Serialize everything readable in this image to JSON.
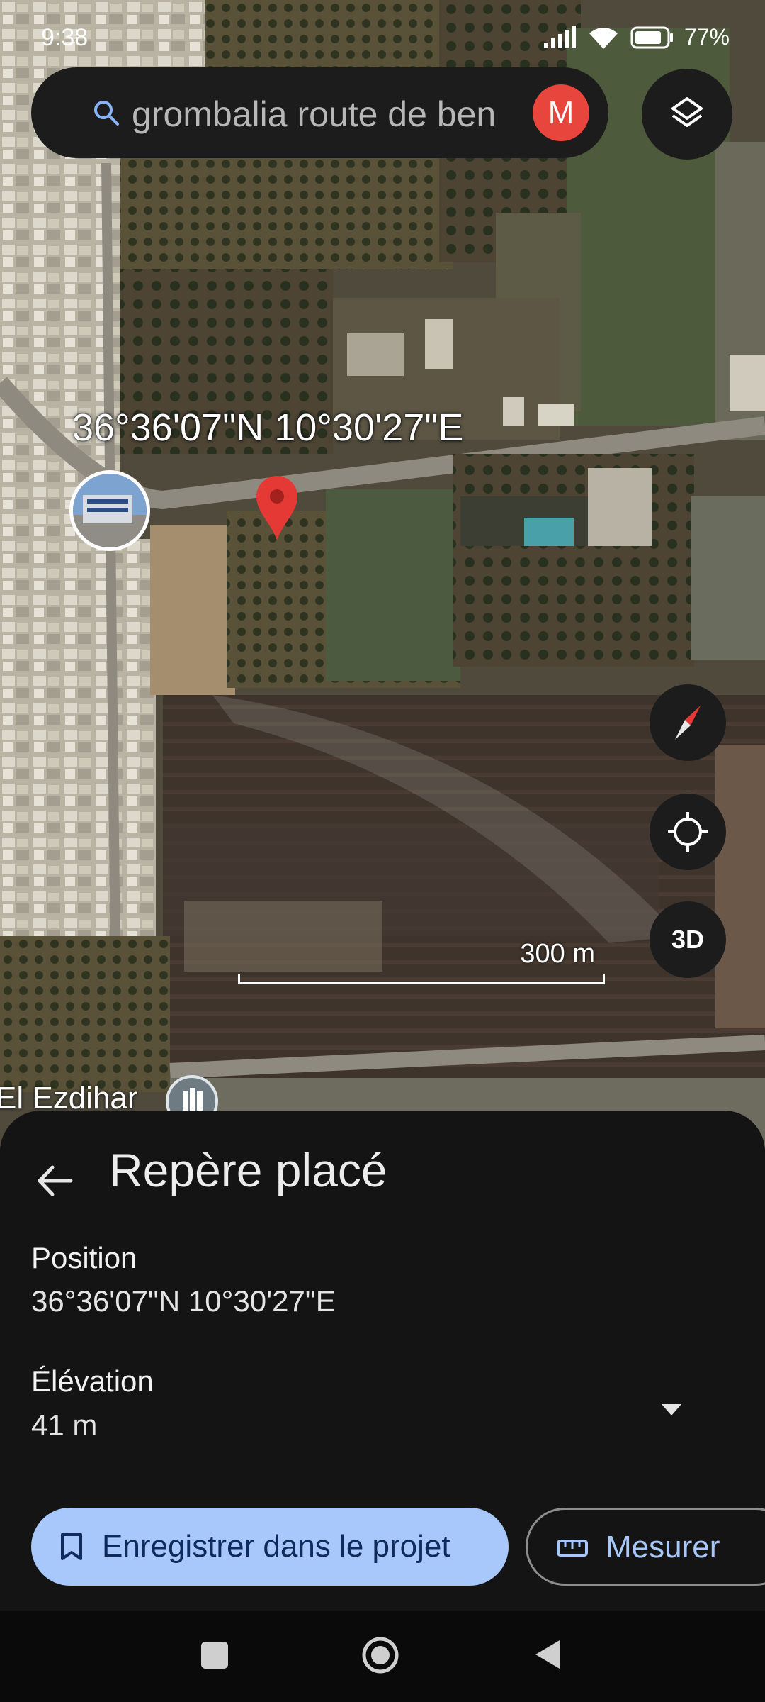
{
  "status_bar": {
    "time": "9:38",
    "battery": "77%",
    "icons": [
      "signal-icon",
      "wifi-icon",
      "battery-icon"
    ]
  },
  "search": {
    "query": "grombalia route de ben",
    "avatar_letter": "M",
    "avatar_color": "#e8453c"
  },
  "map": {
    "coordinates_label": "36°36'07\"N 10°30'27\"E",
    "scale_label": "300 m",
    "place_name": "El Ezdihar",
    "controls": [
      "compass-icon",
      "my-location-icon",
      "3D"
    ]
  },
  "sheet": {
    "title": "Repère placé",
    "position_label": "Position",
    "position_value": "36°36'07\"N 10°30'27\"E",
    "elevation_label": "Élévation",
    "elevation_value": "41 m",
    "save_button": "Enregistrer dans le projet",
    "measure_button": "Mesurer"
  },
  "colors": {
    "accent": "#a8c7fa",
    "pin": "#e53935",
    "sheet_bg": "#141414"
  }
}
